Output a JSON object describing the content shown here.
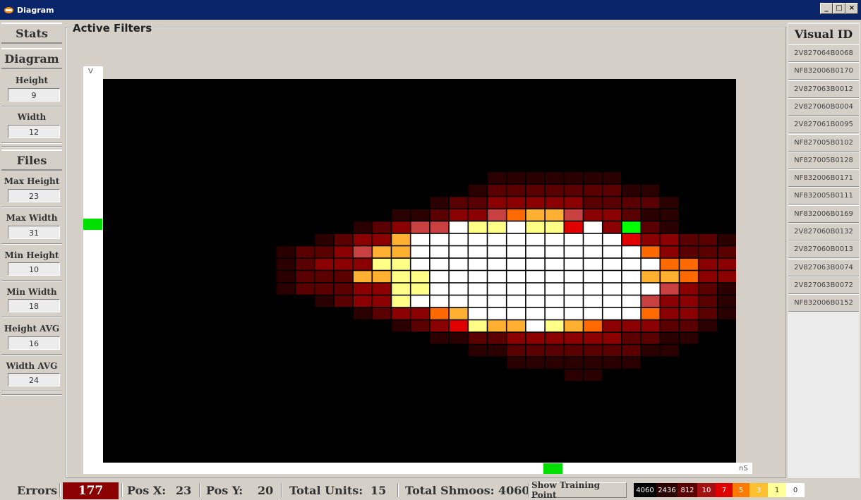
{
  "window": {
    "title": "Diagram",
    "buttons": [
      "_",
      "□",
      "×"
    ]
  },
  "left_panel": {
    "stats_label": "Stats",
    "diagram_label": "Diagram",
    "height_label": "Height",
    "height_value": "9",
    "width_label": "Width",
    "width_value": "12",
    "files_label": "Files",
    "max_height_label": "Max Height",
    "max_height_value": "23",
    "max_width_label": "Max Width",
    "max_width_value": "31",
    "min_height_label": "Min Height",
    "min_height_value": "10",
    "min_width_label": "Min Width",
    "min_width_value": "18",
    "height_avg_label": "Height AVG",
    "height_avg_value": "16",
    "width_avg_label": "Width AVG",
    "width_avg_value": "24"
  },
  "main": {
    "filters_title": "Active Filters",
    "y_axis_label": "V",
    "x_axis_label": "nS",
    "colors": {
      "background": "#000000",
      "marker": "#00e000",
      "cell_border": "#3a0000"
    },
    "heatmap": {
      "cols": 33,
      "rows": 20,
      "palette": {
        "1": "#2a0000",
        "2": "#5a0000",
        "3": "#8b0000",
        "4": "#a51010",
        "5": "#c84040",
        "6": "#e00000",
        "7": "#ff6a00",
        "8": "#ffb030",
        "9": "#ffff88",
        "10": "#ffffff",
        "G": "#00ff00"
      },
      "cells": [
        "...................................................",
        "...............1111111..........",
        "..............1222222211........",
        "............1223333322221.......",
        "..........112335788533211.......",
        "........12355A:9A9:6A3G21.......",
        "......12338AAAAAAAAAAA6332211...",
        "....1223588AAAAAAAAAAAA7322211..",
        "....1233399AAAAAAAAAAAAA77332211",
        "....12228899AAAAAAAAAAA8873322",
        "....12223399AAAAAAAAAAAA53211",
        "......12339AAAAAAAAAAAA53321.",
        "........123378AAAAAAAAA73321",
        "..........1236988A987333221.",
        "............11223333332211...",
        "..............11222222211....",
        "................1111111......",
        "...................11........"
      ]
    }
  },
  "visual_id": {
    "title": "Visual ID",
    "items": [
      "2V827064B0068",
      "NF832006B0170",
      "2V827063B0012",
      "2V827060B0004",
      "2V827061B0095",
      "NF827005B0102",
      "NF827005B0128",
      "NF832006B0171",
      "NF832005B0111",
      "NF832006B0169",
      "2V827060B0132",
      "2V827060B0013",
      "2V827063B0074",
      "2V827063B0072",
      "NF832006B0152"
    ]
  },
  "status": {
    "errors_label": "Errors",
    "errors_value": "177",
    "pos_x_label": "Pos X:",
    "pos_x_value": "23",
    "pos_y_label": "Pos Y:",
    "pos_y_value": "20",
    "total_units_label": "Total Units:",
    "total_units_value": "15",
    "total_shmoos_label": "Total Shmoos:",
    "total_shmoos_value": "4060",
    "training_button": "Show Training Point",
    "legend": [
      {
        "label": "4060",
        "color": "#000000",
        "text": "#ffffff"
      },
      {
        "label": "2436",
        "color": "#2a0000",
        "text": "#ffffff"
      },
      {
        "label": "812",
        "color": "#5a0000",
        "text": "#ffffff"
      },
      {
        "label": "10",
        "color": "#a51010",
        "text": "#ffffff"
      },
      {
        "label": "7",
        "color": "#e00000",
        "text": "#ffffff"
      },
      {
        "label": "5",
        "color": "#ff7a00",
        "text": "#ffffff"
      },
      {
        "label": "3",
        "color": "#ffc030",
        "text": "#ffffff"
      },
      {
        "label": "1",
        "color": "#ffff99",
        "text": "#333333"
      },
      {
        "label": "0",
        "color": "#ffffff",
        "text": "#333333"
      }
    ]
  }
}
